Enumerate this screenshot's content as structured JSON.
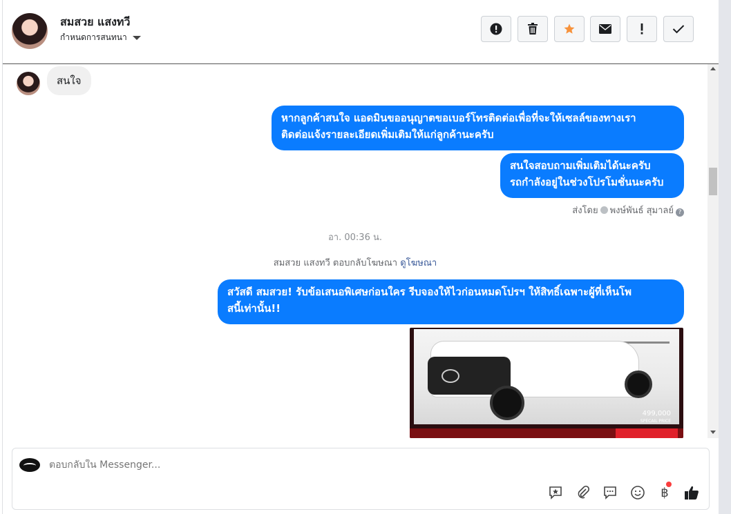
{
  "header": {
    "contact_name": "สมสวย แสงทวี",
    "assign_label": "กำหนดการสนทนา",
    "actions": [
      {
        "name": "report-spam-button",
        "icon": "exclamation-circle-icon"
      },
      {
        "name": "delete-button",
        "icon": "trash-icon"
      },
      {
        "name": "star-button",
        "icon": "star-icon",
        "color": "#f7923b"
      },
      {
        "name": "mark-unread-button",
        "icon": "envelope-icon"
      },
      {
        "name": "follow-up-button",
        "icon": "exclamation-icon"
      },
      {
        "name": "done-button",
        "icon": "checkmark-icon"
      }
    ]
  },
  "messages": {
    "incoming_1": "สนใจ",
    "outgoing_1_line1": "หากลูกค้าสนใจ แอดมินขออนุญาตขอเบอร์โทรติดต่อเพื่อที่จะให้เซลล์ของทางเรา",
    "outgoing_1_line2": "ติดต่อแจ้งรายละเอียดเพิ่มเติมให้แก่ลูกค้านะครับ",
    "outgoing_2_line1": "สนใจสอบถามเพิ่มเติมได้นะครับ",
    "outgoing_2_line2": "รถกำลังอยู่ในช่วงโปรโมชั่นนะครับ",
    "sent_by_label": "ส่งโดย",
    "sent_by_name": "พงษ์พันธ์ สุมาลย์",
    "timestamp": "อา. 00:36 น.",
    "ad_reply_text": "สมสวย แสงทวี ตอบกลับโฆษณา",
    "ad_reply_link": "ดูโฆษณา",
    "outgoing_3_line1": "สวัสดี สมสวย! รับข้อเสนอพิเศษก่อนใคร รีบจองให้ไวก่อนหมดโปรฯ ให้สิทธิ์เฉพาะผู้ที่เห็นโพ",
    "outgoing_3_line2": "สนี้เท่านั้น!!",
    "ad_price": "499,000",
    "ad_price_caption": "SPECAIL PRICE"
  },
  "composer": {
    "placeholder": "ตอบกลับใน Messenger...",
    "tools": [
      "saved-reply-icon",
      "attachment-icon",
      "chat-bubble-icon",
      "emoji-icon",
      "baht-payment-icon",
      "like-icon"
    ],
    "baht_symbol": "฿"
  },
  "colors": {
    "outgoing_bubble": "#0a7cff",
    "incoming_bubble": "#f0f0f0",
    "star": "#f7923b",
    "notification_dot": "#fa3e3e"
  }
}
